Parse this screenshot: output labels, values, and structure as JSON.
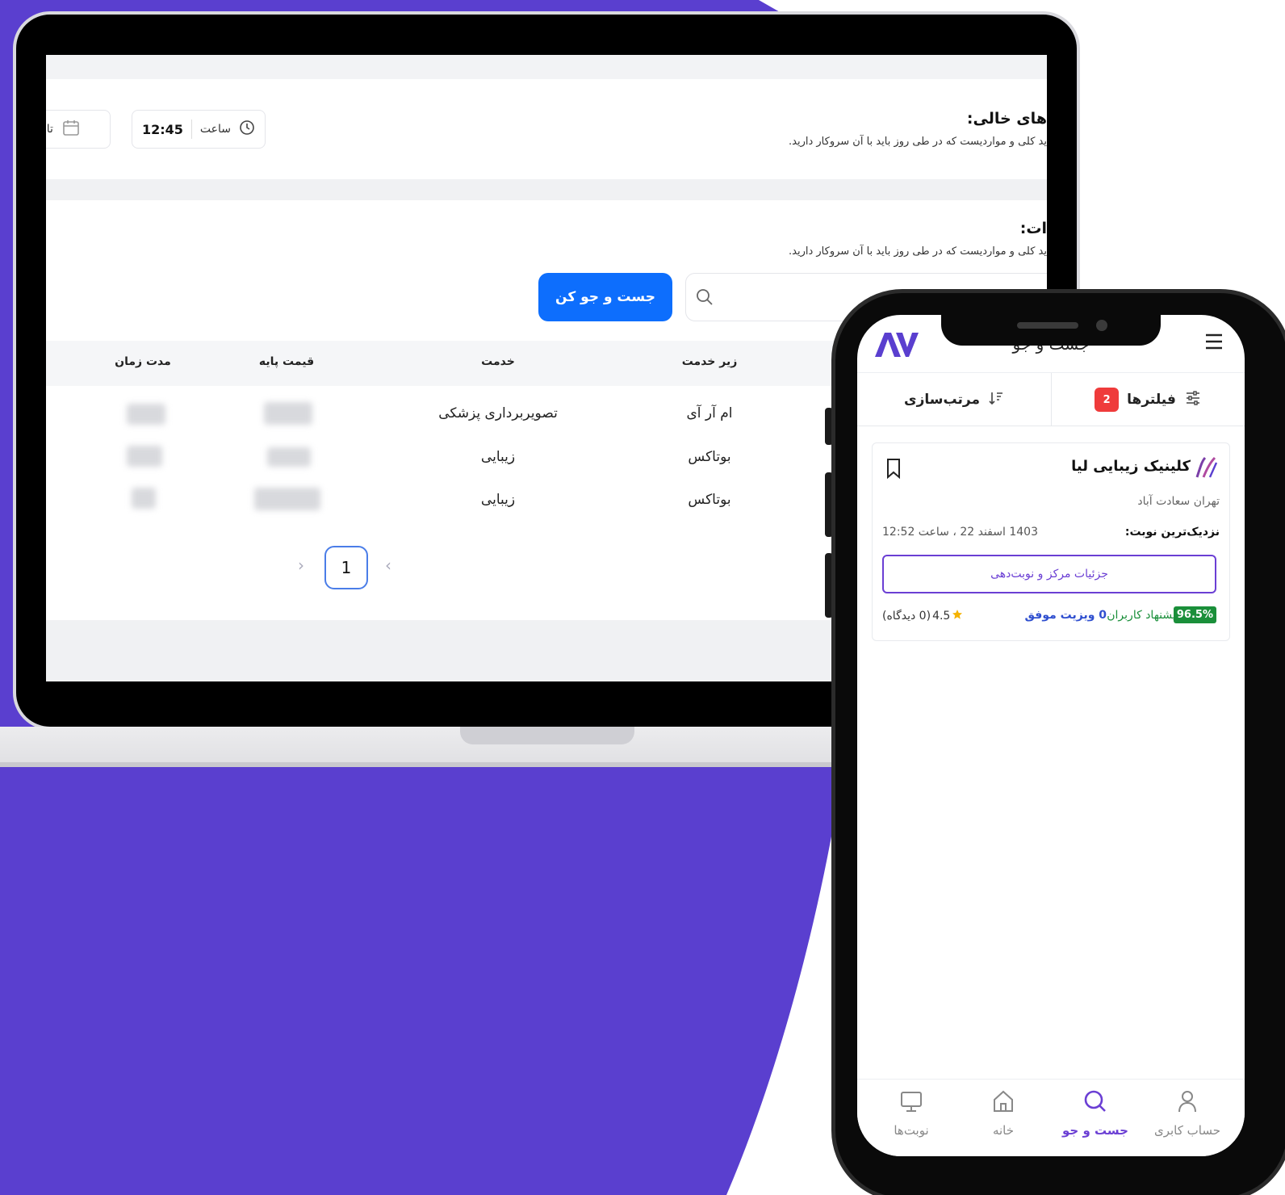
{
  "colors": {
    "background_purple": "#5a3fcf",
    "primary_blue": "#0d6efd",
    "brand_purple": "#6b3fd4",
    "badge_red": "#ef3b3b",
    "success_green": "#1a8f3a",
    "visit_blue": "#2f4fcf"
  },
  "laptop": {
    "empty_section": {
      "title": "های خالی:",
      "description": "ید کلی و مواردیست که در طی روز باید با آن سروکار دارید."
    },
    "time_filter": {
      "label": "ساعت",
      "value": "12:45",
      "icon": "clock-icon"
    },
    "date_filter": {
      "label": "تاری",
      "icon": "calendar-icon"
    },
    "services_section": {
      "title": "ات:",
      "description": "ید کلی و مواردیست که در طی روز باید با آن سروکار دارید."
    },
    "search": {
      "placeholder": "",
      "button_label": "جست و جو کن",
      "icon": "search-icon"
    },
    "table": {
      "headers": {
        "sub_service": "زیر خدمت",
        "service": "خدمت",
        "base_price": "قیمت پایه",
        "duration": "مدت زمان"
      },
      "rows": [
        {
          "sub_service": "ام آر آی",
          "service": "تصویربرداری پزشکی"
        },
        {
          "sub_service": "بوتاکس",
          "service": "زیبایی"
        },
        {
          "sub_service": "بوتاکس",
          "service": "زیبایی"
        }
      ]
    },
    "pagination": {
      "current": "1",
      "prev": "‹",
      "next": "›"
    }
  },
  "phone": {
    "header": {
      "title": "جست و جو",
      "logo": "AV-logo",
      "menu_icon": "hamburger-menu-icon"
    },
    "tabs": {
      "filters": {
        "label": "فیلترها",
        "badge": "2",
        "icon": "sliders-icon"
      },
      "sort": {
        "label": "مرتب‌سازی",
        "icon": "sort-icon"
      }
    },
    "clinic_card": {
      "name": "کلینیک زیبایی لیا",
      "address": "تهران سعادت آباد",
      "next_appointment_label": "نزدیک‌ترین نوبت:",
      "next_appointment_value": "1403 اسفند 22 ، ساعت 12:52",
      "details_button": "جزئیات مرکز و نوبت‌دهی",
      "recommend_pct": "96.5%",
      "recommend_label": "پیشنهاد کاربران",
      "visits": "0 ویزیت موفق",
      "rating": "4.5",
      "reviews": "(0 دیدگاه)"
    },
    "bottom_nav": {
      "items": [
        {
          "label": "حساب کابری",
          "icon": "user-icon",
          "active": false
        },
        {
          "label": "جست و جو",
          "icon": "search-icon",
          "active": true
        },
        {
          "label": "خانه",
          "icon": "home-icon",
          "active": false
        },
        {
          "label": "نوبت‌ها",
          "icon": "monitor-icon",
          "active": false
        }
      ]
    }
  }
}
